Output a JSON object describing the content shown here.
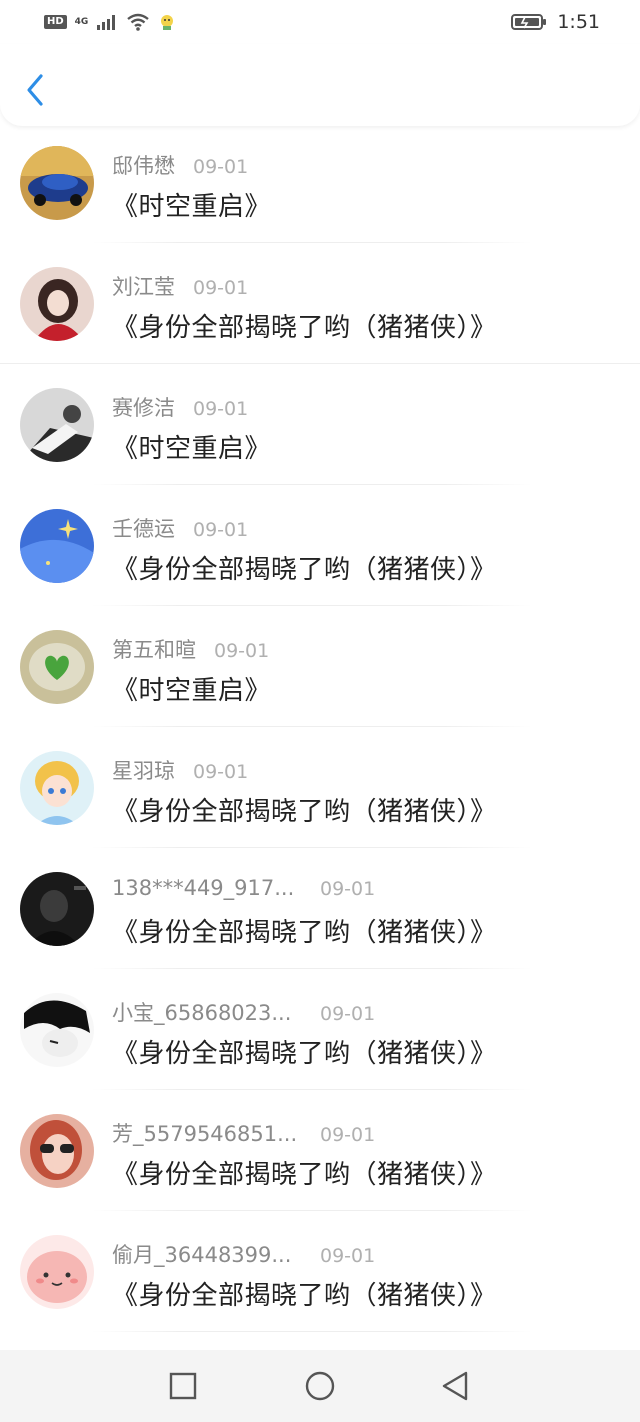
{
  "status_bar": {
    "left_badge": "HD",
    "network": "4G",
    "time": "1:51"
  },
  "colors": {
    "accent": "#2e8ee6",
    "name_text": "#8a8a8a",
    "date_text": "#b0b0b0",
    "title_text": "#222222"
  },
  "header": {
    "back_icon": "chevron-left-icon"
  },
  "list": {
    "items": [
      {
        "name": "邸伟懋",
        "date": "09-01",
        "title": "《时空重启》"
      },
      {
        "name": "刘江莹",
        "date": "09-01",
        "title": "《身份全部揭晓了哟（猪猪侠）》"
      },
      {
        "name": "赛修洁",
        "date": "09-01",
        "title": "《时空重启》"
      },
      {
        "name": "壬德运",
        "date": "09-01",
        "title": "《身份全部揭晓了哟（猪猪侠）》"
      },
      {
        "name": "第五和暄",
        "date": "09-01",
        "title": "《时空重启》"
      },
      {
        "name": "星羽琼",
        "date": "09-01",
        "title": "《身份全部揭晓了哟（猪猪侠）》"
      },
      {
        "name": "138***449_917...",
        "date": "09-01",
        "title": "《身份全部揭晓了哟（猪猪侠）》"
      },
      {
        "name": "小宝_65868023...",
        "date": "09-01",
        "title": "《身份全部揭晓了哟（猪猪侠）》"
      },
      {
        "name": "芳_5579546851...",
        "date": "09-01",
        "title": "《身份全部揭晓了哟（猪猪侠）》"
      },
      {
        "name": "偷月_36448399...",
        "date": "09-01",
        "title": "《身份全部揭晓了哟（猪猪侠）》"
      }
    ]
  },
  "nav_bar": {
    "recent_icon": "square-recent-apps-icon",
    "home_icon": "circle-home-icon",
    "back_icon": "triangle-back-icon"
  }
}
